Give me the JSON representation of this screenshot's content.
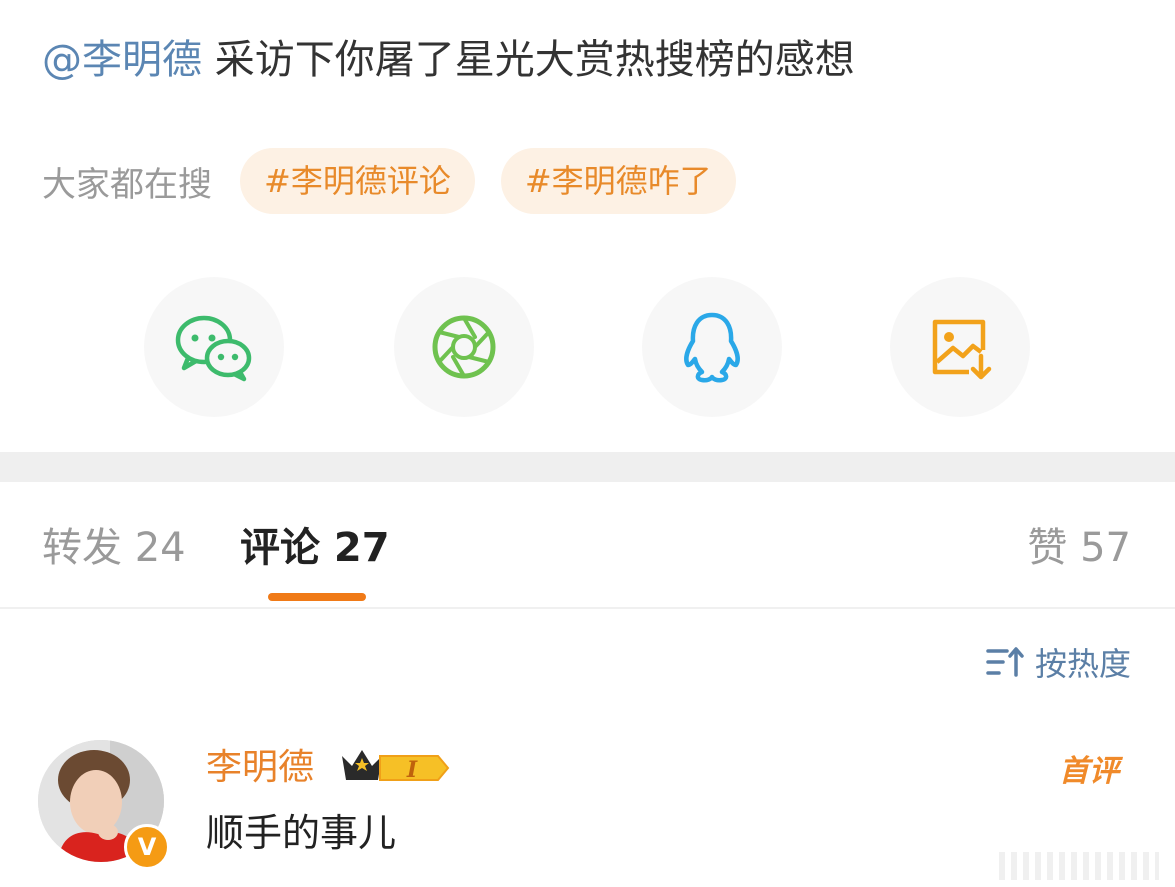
{
  "post": {
    "mention": "@李明德",
    "text": " 采访下你屠了星光大赏热搜榜的感想"
  },
  "search": {
    "label": "大家都在搜",
    "tags": [
      "#李明德评论",
      "#李明德咋了"
    ]
  },
  "share": [
    {
      "icon": "wechat-icon",
      "color": "#3dbb6c"
    },
    {
      "icon": "moments-icon",
      "color": "#6fc24f"
    },
    {
      "icon": "qq-icon",
      "color": "#2aa8e8"
    },
    {
      "icon": "save-image-icon",
      "color": "#f2a21b"
    }
  ],
  "tabs": {
    "repost": "转发 24",
    "comment": "评论 27",
    "like": "赞 57"
  },
  "sort": {
    "label": "按热度"
  },
  "comment": {
    "name": "李明德",
    "level": "I",
    "text": "顺手的事儿",
    "badge": "首评",
    "verify": "V"
  },
  "colors": {
    "accent": "#f07a17",
    "link": "#5b86b3",
    "tag_bg": "#fdf1e4",
    "tag_text": "#e88a2a"
  }
}
